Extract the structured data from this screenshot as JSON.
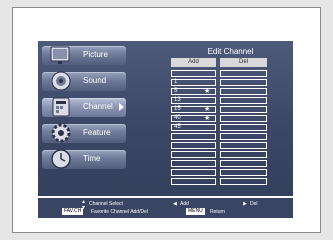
{
  "menu": {
    "items": [
      {
        "label": "Picture",
        "icon": "tv-icon"
      },
      {
        "label": "Sound",
        "icon": "speaker-icon"
      },
      {
        "label": "Channel",
        "icon": "channel-icon"
      },
      {
        "label": "Feature",
        "icon": "gear-icon"
      },
      {
        "label": "Time",
        "icon": "clock-icon"
      }
    ],
    "active_index": 2
  },
  "edit_channel": {
    "title": "Edit Channel",
    "col_add": "Add",
    "col_del": "Del",
    "rows": [
      {
        "channel": "",
        "favorite": false
      },
      {
        "channel": "1",
        "favorite": false
      },
      {
        "channel": "5",
        "favorite": true
      },
      {
        "channel": "13",
        "favorite": false
      },
      {
        "channel": "15",
        "favorite": true
      },
      {
        "channel": "40",
        "favorite": true
      },
      {
        "channel": "45",
        "favorite": false
      },
      {
        "channel": "",
        "favorite": false
      },
      {
        "channel": "",
        "favorite": false
      },
      {
        "channel": "",
        "favorite": false
      },
      {
        "channel": "",
        "favorite": false
      },
      {
        "channel": "",
        "favorite": false
      },
      {
        "channel": "",
        "favorite": false
      }
    ],
    "star_glyph": "★"
  },
  "footer": {
    "channel_select": "Channel Select",
    "add": "Add",
    "del": "Del",
    "fav_key": "FAV.CH",
    "fav_text": "Favorite Channel Add/Del",
    "menu_key": "MENU",
    "return": "Return"
  },
  "colors": {
    "panel": "#3c4766",
    "page_bg": "#e6e6e6",
    "text": "#ffffff"
  }
}
